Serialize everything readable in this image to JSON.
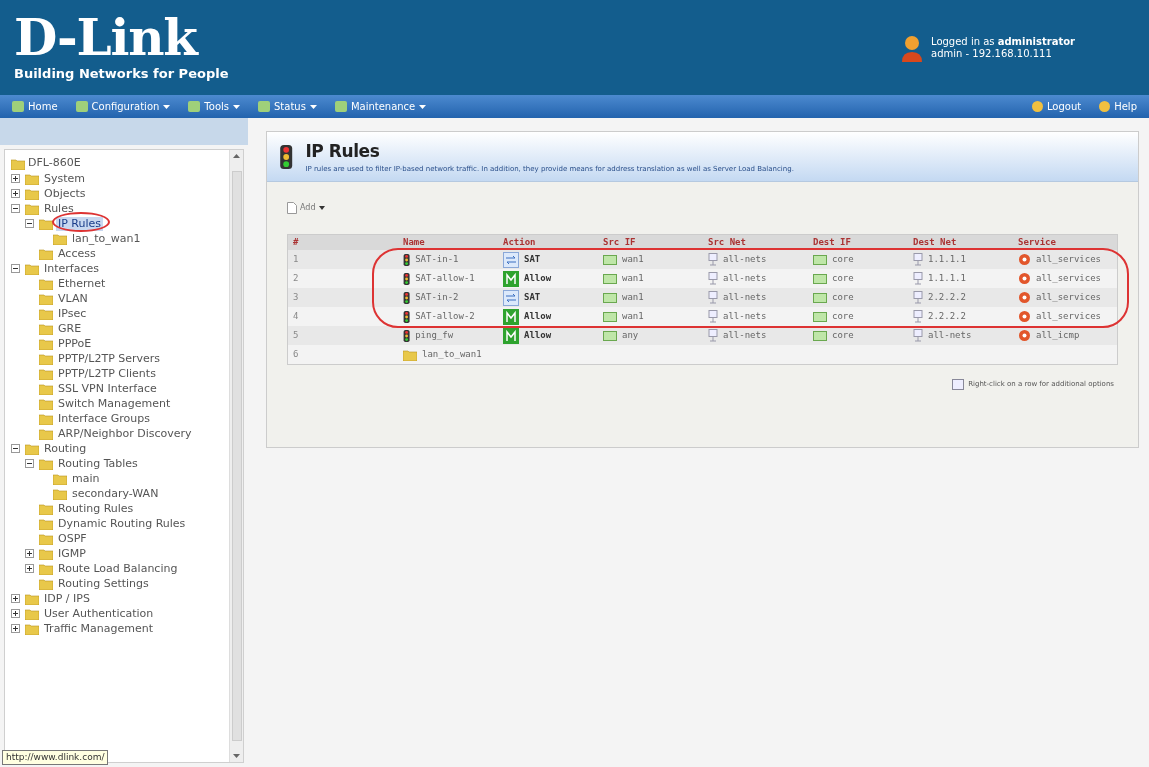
{
  "brand": {
    "logo": "D-Link",
    "tagline": "Building Networks for People"
  },
  "user": {
    "login": "Logged in as **administrator**",
    "session": "admin - 192.168.10.111"
  },
  "menu": [
    {
      "label": "Home",
      "dropdown": false
    },
    {
      "label": "Configuration",
      "dropdown": true
    },
    {
      "label": "Tools",
      "dropdown": true
    },
    {
      "label": "Status",
      "dropdown": true
    },
    {
      "label": "Maintenance",
      "dropdown": true
    }
  ],
  "menu_right": [
    "Logout",
    "Help"
  ],
  "tree": {
    "label": "DFL-860E",
    "children": [
      {
        "label": "System",
        "expanded": false,
        "selected": false
      },
      {
        "label": "Objects",
        "expanded": false,
        "selected": false
      },
      {
        "label": "Rules",
        "expanded": true,
        "selected": false,
        "children": [
          {
            "label": "IP Rules",
            "expanded": true,
            "selected": true,
            "children": [
              {
                "label": "lan_to_wan1",
                "selected": false
              }
            ]
          },
          {
            "label": "Access",
            "selected": false
          }
        ]
      },
      {
        "label": "Interfaces",
        "expanded": true,
        "selected": false,
        "children": [
          {
            "label": "Ethernet",
            "selected": false
          },
          {
            "label": "VLAN",
            "selected": false
          },
          {
            "label": "IPsec",
            "selected": false
          },
          {
            "label": "GRE",
            "selected": false
          },
          {
            "label": "PPPoE",
            "selected": false
          },
          {
            "label": "PPTP/L2TP Servers",
            "selected": false
          },
          {
            "label": "PPTP/L2TP Clients",
            "selected": false
          },
          {
            "label": "SSL VPN Interface",
            "selected": false
          },
          {
            "label": "Switch Management",
            "selected": false
          },
          {
            "label": "Interface Groups",
            "selected": false
          },
          {
            "label": "ARP/Neighbor Discovery",
            "selected": false
          }
        ]
      },
      {
        "label": "Routing",
        "expanded": true,
        "selected": false,
        "children": [
          {
            "label": "Routing Tables",
            "expanded": true,
            "selected": false,
            "children": [
              {
                "label": "main",
                "selected": false
              },
              {
                "label": "secondary-WAN",
                "selected": false
              }
            ]
          },
          {
            "label": "Routing Rules",
            "selected": false
          },
          {
            "label": "Dynamic Routing Rules",
            "selected": false
          },
          {
            "label": "OSPF",
            "selected": false
          },
          {
            "label": "IGMP",
            "expanded": false,
            "selected": false
          },
          {
            "label": "Route Load Balancing",
            "expanded": false,
            "selected": false
          },
          {
            "label": "Routing Settings",
            "selected": false
          }
        ]
      },
      {
        "label": "IDP / IPS",
        "expanded": false,
        "selected": false
      },
      {
        "label": "User Authentication",
        "expanded": false,
        "selected": false
      },
      {
        "label": "Traffic Management",
        "expanded": false,
        "selected": false
      }
    ]
  },
  "status_tooltip": "http://www.dlink.com/",
  "page": {
    "title": "IP Rules",
    "description": "IP rules are used to filter IP-based network traffic. In addition, they provide means for address translation as well as Server Load Balancing.",
    "add_button": "Add"
  },
  "table": {
    "columns": [
      "#",
      "Name",
      "Action",
      "Src IF",
      "Src Net",
      "Dest IF",
      "Dest Net",
      "Service"
    ],
    "rows": [
      {
        "kind": "rule",
        "index": "1",
        "name": "SAT-in-1",
        "action": {
          "kind": "sat",
          "label": "SAT"
        },
        "src_if": "wan1",
        "src_net": "all-nets",
        "dest_if": "core",
        "dest_net": "1.1.1.1",
        "service": "all_services"
      },
      {
        "kind": "rule",
        "index": "2",
        "name": "SAT-allow-1",
        "action": {
          "kind": "allow",
          "label": "Allow"
        },
        "src_if": "wan1",
        "src_net": "all-nets",
        "dest_if": "core",
        "dest_net": "1.1.1.1",
        "service": "all_services"
      },
      {
        "kind": "rule",
        "index": "3",
        "name": "SAT-in-2",
        "action": {
          "kind": "sat",
          "label": "SAT"
        },
        "src_if": "wan1",
        "src_net": "all-nets",
        "dest_if": "core",
        "dest_net": "2.2.2.2",
        "service": "all_services"
      },
      {
        "kind": "rule",
        "index": "4",
        "name": "SAT-allow-2",
        "action": {
          "kind": "allow",
          "label": "Allow"
        },
        "src_if": "wan1",
        "src_net": "all-nets",
        "dest_if": "core",
        "dest_net": "2.2.2.2",
        "service": "all_services"
      },
      {
        "kind": "rule",
        "index": "5",
        "name": "ping_fw",
        "action": {
          "kind": "allow",
          "label": "Allow"
        },
        "src_if": "any",
        "src_net": "all-nets",
        "dest_if": "core",
        "dest_net": "all-nets",
        "service": "all_icmp"
      },
      {
        "kind": "folder",
        "index": "6",
        "name": "lan_to_wan1"
      }
    ]
  },
  "hint": "Right-click on a row for additional options"
}
